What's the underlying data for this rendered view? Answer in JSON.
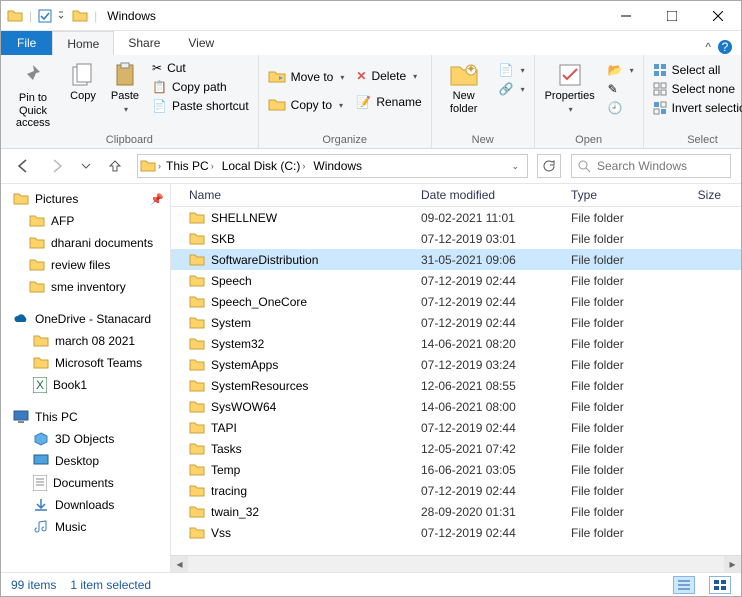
{
  "title": "Windows",
  "ribbonTabs": {
    "file": "File",
    "home": "Home",
    "share": "Share",
    "view": "View"
  },
  "ribbon": {
    "clipboard": {
      "label": "Clipboard",
      "pinToQuick": "Pin to Quick\naccess",
      "copy": "Copy",
      "paste": "Paste",
      "cut": "Cut",
      "copyPath": "Copy path",
      "pasteShortcut": "Paste shortcut"
    },
    "organize": {
      "label": "Organize",
      "moveTo": "Move to",
      "copyTo": "Copy to",
      "delete": "Delete",
      "rename": "Rename"
    },
    "new": {
      "label": "New",
      "newFolder": "New\nfolder"
    },
    "open": {
      "label": "Open",
      "properties": "Properties"
    },
    "select": {
      "label": "Select",
      "selectAll": "Select all",
      "selectNone": "Select none",
      "invert": "Invert selection"
    }
  },
  "breadcrumb": [
    "This PC",
    "Local Disk (C:)",
    "Windows"
  ],
  "searchPlaceholder": "Search Windows",
  "nav": {
    "pictures": "Pictures",
    "afp": "AFP",
    "dharani": "dharani documents",
    "review": "review files",
    "sme": "sme inventory",
    "onedrive": "OneDrive - Stanacard",
    "march": "march 08 2021",
    "msteams": "Microsoft Teams",
    "book1": "Book1",
    "thispc": "This PC",
    "obj3d": "3D Objects",
    "desktop": "Desktop",
    "documents": "Documents",
    "downloads": "Downloads",
    "music": "Music"
  },
  "columns": {
    "name": "Name",
    "date": "Date modified",
    "type": "Type",
    "size": "Size"
  },
  "files": [
    {
      "name": "SHELLNEW",
      "date": "09-02-2021 11:01",
      "type": "File folder"
    },
    {
      "name": "SKB",
      "date": "07-12-2019 03:01",
      "type": "File folder"
    },
    {
      "name": "SoftwareDistribution",
      "date": "31-05-2021 09:06",
      "type": "File folder",
      "selected": true
    },
    {
      "name": "Speech",
      "date": "07-12-2019 02:44",
      "type": "File folder"
    },
    {
      "name": "Speech_OneCore",
      "date": "07-12-2019 02:44",
      "type": "File folder"
    },
    {
      "name": "System",
      "date": "07-12-2019 02:44",
      "type": "File folder"
    },
    {
      "name": "System32",
      "date": "14-06-2021 08:20",
      "type": "File folder"
    },
    {
      "name": "SystemApps",
      "date": "07-12-2019 03:24",
      "type": "File folder"
    },
    {
      "name": "SystemResources",
      "date": "12-06-2021 08:55",
      "type": "File folder"
    },
    {
      "name": "SysWOW64",
      "date": "14-06-2021 08:00",
      "type": "File folder"
    },
    {
      "name": "TAPI",
      "date": "07-12-2019 02:44",
      "type": "File folder"
    },
    {
      "name": "Tasks",
      "date": "12-05-2021 07:42",
      "type": "File folder"
    },
    {
      "name": "Temp",
      "date": "16-06-2021 03:05",
      "type": "File folder"
    },
    {
      "name": "tracing",
      "date": "07-12-2019 02:44",
      "type": "File folder"
    },
    {
      "name": "twain_32",
      "date": "28-09-2020 01:31",
      "type": "File folder"
    },
    {
      "name": "Vss",
      "date": "07-12-2019 02:44",
      "type": "File folder"
    }
  ],
  "status": {
    "items": "99 items",
    "selected": "1 item selected"
  }
}
